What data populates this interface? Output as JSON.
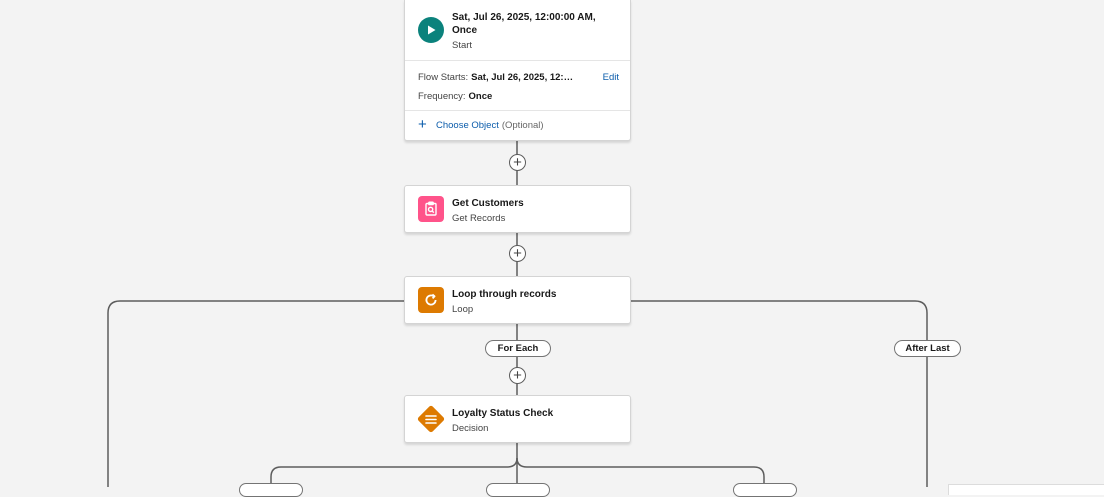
{
  "start_node": {
    "title": "Sat, Jul 26, 2025, 12:00:00 AM, Once",
    "subtitle": "Start",
    "icon": "play-icon",
    "flow_starts_label": "Flow Starts:",
    "flow_starts_value": "Sat, Jul 26, 2025, 12:…",
    "edit_label": "Edit",
    "frequency_label": "Frequency:",
    "frequency_value": "Once",
    "choose_object_label": "Choose Object",
    "optional_label": "(Optional)"
  },
  "nodes": [
    {
      "title": "Get Customers",
      "subtitle": "Get Records",
      "icon": "get-records-icon",
      "color": "#ff538a"
    },
    {
      "title": "Loop through records",
      "subtitle": "Loop",
      "icon": "loop-icon",
      "color": "#dd7a01"
    },
    {
      "title": "Loyalty Status Check",
      "subtitle": "Decision",
      "icon": "decision-icon",
      "color": "#dd7a01"
    }
  ],
  "connector_labels": {
    "for_each": "For Each",
    "after_last": "After Last"
  },
  "colors": {
    "canvas": "#f3f3f3",
    "connector": "#5c5c5c",
    "start": "#0b827c",
    "link": "#0b5cab"
  }
}
